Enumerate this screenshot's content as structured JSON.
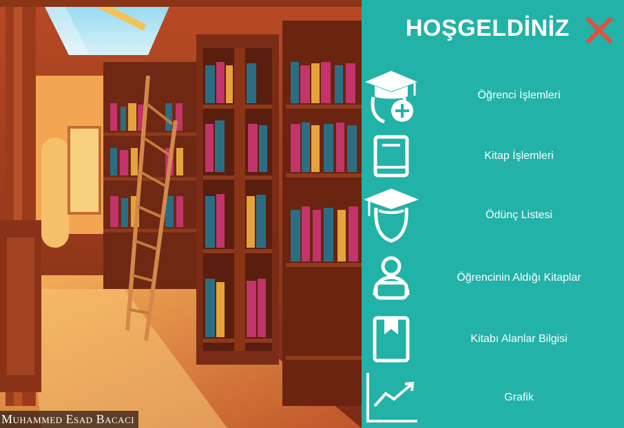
{
  "app": {
    "credit_text": "Muhammed Esad Bacacı"
  },
  "panel": {
    "title": "HOŞGELDİNİZ",
    "close_icon": "close-x-icon",
    "colors": {
      "background": "#22b2a7",
      "close": "#e84c3d",
      "text": "#ffffff"
    },
    "menu": [
      {
        "label": "Öğrenci İşlemleri",
        "icon": "student-add-icon"
      },
      {
        "label": "Kitap İşlemleri",
        "icon": "book-icon"
      },
      {
        "label": "Ödünç Listesi",
        "icon": "graduate-icon"
      },
      {
        "label": "Öğrencinin Aldığı Kitaplar",
        "icon": "reader-icon"
      },
      {
        "label": "Kitabı Alanlar Bilgisi",
        "icon": "bookmark-book-icon"
      },
      {
        "label": "Grafik",
        "icon": "chart-icon"
      }
    ]
  }
}
